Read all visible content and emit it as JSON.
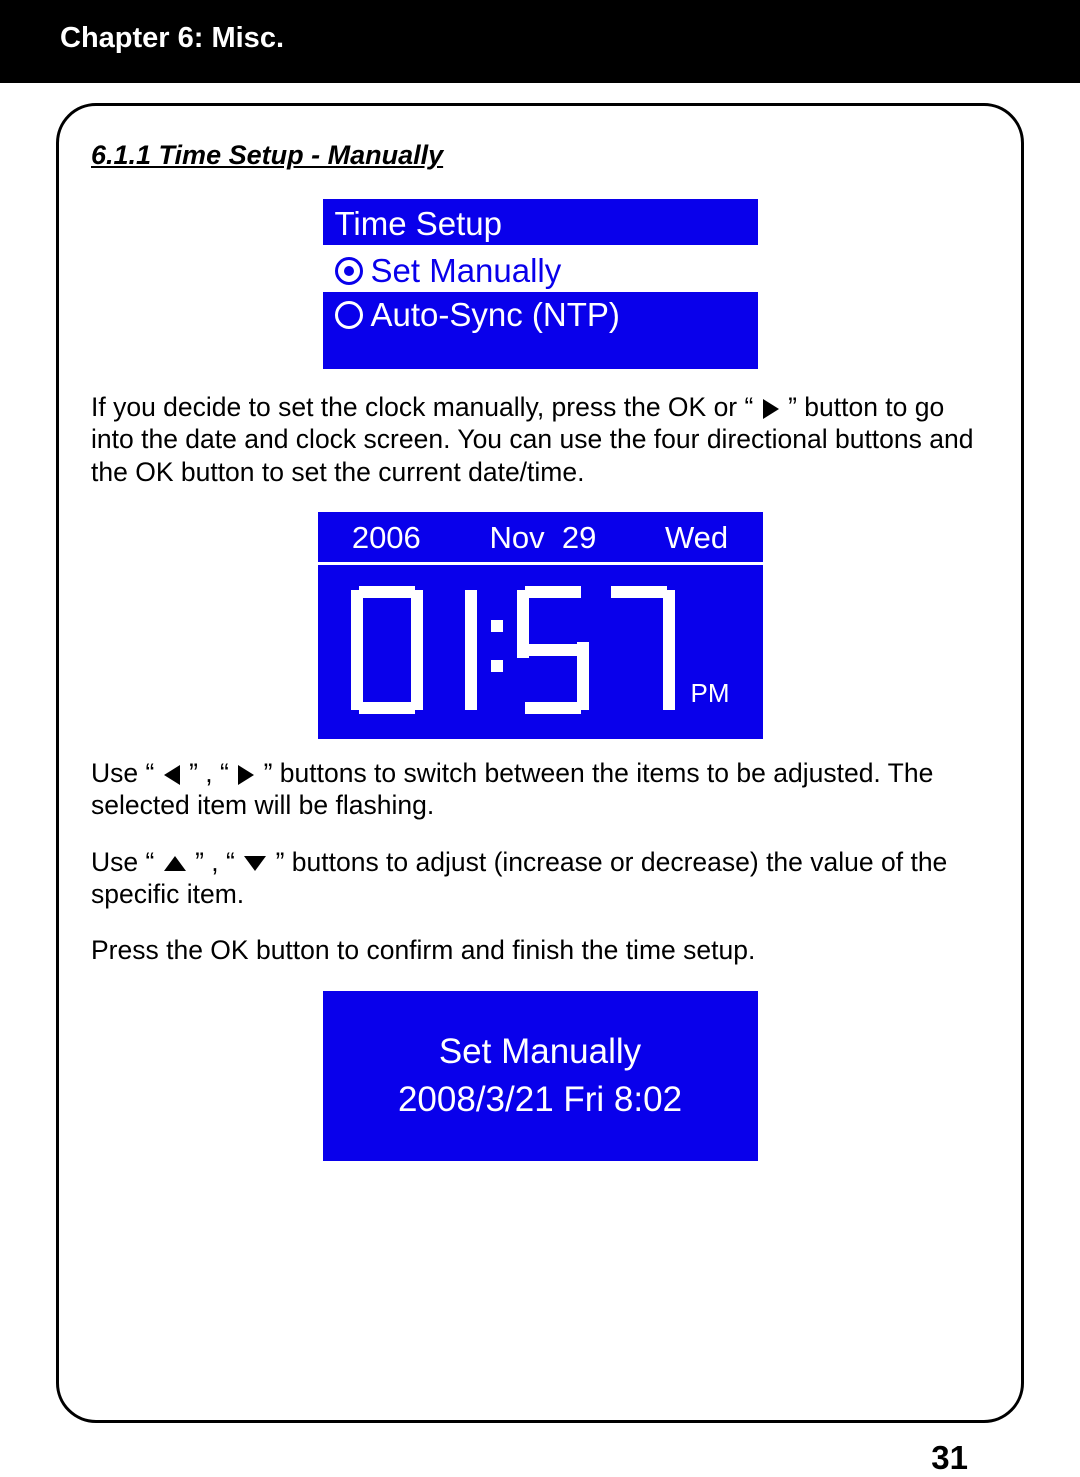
{
  "chapter_title": "Chapter 6: Misc.",
  "section_title": "6.1.1 Time Setup - Manually",
  "lcd1": {
    "title": "Time Setup",
    "opt_selected": "Set Manually",
    "opt_other": "Auto-Sync (NTP)"
  },
  "para1_a": "If you decide to set the clock manually, press the OK or “",
  "para1_b": "” button to go into the date and clock screen. You can use the four directional buttons and the OK button to set the current date/time.",
  "lcd2": {
    "year": "2006",
    "month": "Nov",
    "day": "29",
    "weekday": "Wed",
    "time": "01:57",
    "ampm": "PM"
  },
  "para2_a": "Use “",
  "para2_b": "” , “",
  "para2_c": "” buttons to switch between the items to be adjusted. The selected item will be flashing.",
  "para3_a": "Use “",
  "para3_b": "” , “",
  "para3_c": "” buttons to adjust (increase or decrease) the value of the specific item.",
  "para4": "Press the OK button to confirm and finish the time setup.",
  "lcd3": {
    "line1": "Set Manually",
    "line2": "2008/3/21 Fri 8:02"
  },
  "page_number": "31"
}
